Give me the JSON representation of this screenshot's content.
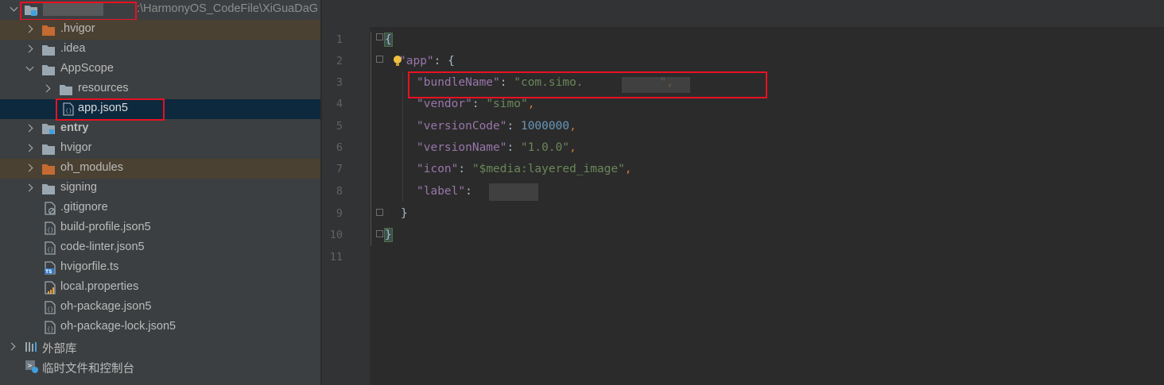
{
  "project_tree": {
    "root": {
      "path_suffix": ":\\HarmonyOS_CodeFile\\XiGuaDaG"
    },
    "items": [
      {
        "label": ".hvigor",
        "type": "folder",
        "expanded": false,
        "excluded": true
      },
      {
        "label": ".idea",
        "type": "folder",
        "expanded": false
      },
      {
        "label": "AppScope",
        "type": "folder",
        "expanded": true
      },
      {
        "label": "resources",
        "type": "folder",
        "expanded": false
      },
      {
        "label": "app.json5",
        "type": "json5-file",
        "selected": true
      },
      {
        "label": "entry",
        "type": "module-folder",
        "expanded": false
      },
      {
        "label": "hvigor",
        "type": "folder",
        "expanded": false
      },
      {
        "label": "oh_modules",
        "type": "folder",
        "expanded": false,
        "excluded": true
      },
      {
        "label": "signing",
        "type": "folder",
        "expanded": false
      },
      {
        "label": ".gitignore",
        "type": "ignore-file"
      },
      {
        "label": "build-profile.json5",
        "type": "json5-file"
      },
      {
        "label": "code-linter.json5",
        "type": "json5-file"
      },
      {
        "label": "hvigorfile.ts",
        "type": "ts-file"
      },
      {
        "label": "local.properties",
        "type": "properties-file"
      },
      {
        "label": "oh-package.json5",
        "type": "json5-file"
      },
      {
        "label": "oh-package-lock.json5",
        "type": "json5-file"
      },
      {
        "label": "外部库",
        "type": "libraries"
      },
      {
        "label": "临时文件和控制台",
        "type": "scratches"
      }
    ]
  },
  "editor": {
    "line_numbers": [
      "1",
      "2",
      "3",
      "4",
      "5",
      "6",
      "7",
      "8",
      "9",
      "10",
      "11"
    ],
    "lines": {
      "l1": {
        "brace": "{"
      },
      "l2": {
        "key": "\"app\"",
        "colon": ": ",
        "brace": "{"
      },
      "l3": {
        "key": "\"bundleName\"",
        "colon": ": ",
        "val": "\"com.simo.",
        "val_end": "\"",
        "comma": ","
      },
      "l4": {
        "key": "\"vendor\"",
        "colon": ": ",
        "val": "\"simo\"",
        "comma": ","
      },
      "l5": {
        "key": "\"versionCode\"",
        "colon": ": ",
        "num": "1000000",
        "comma": ","
      },
      "l6": {
        "key": "\"versionName\"",
        "colon": ": ",
        "val": "\"1.0.0\"",
        "comma": ","
      },
      "l7": {
        "key": "\"icon\"",
        "colon": ": ",
        "val": "\"$media:layered_image\"",
        "comma": ","
      },
      "l8": {
        "key": "\"label\"",
        "colon": ": "
      },
      "l9": {
        "brace": "}"
      },
      "l10": {
        "brace": "}"
      }
    }
  },
  "colors": {
    "sidebar_bg": "#3c3f41",
    "editor_bg": "#2b2b2b",
    "selection": "#0d293e",
    "excluded_folder": "#c46a33",
    "highlight_box": "#e81123",
    "key": "#9876aa",
    "string": "#6a8759",
    "number": "#6897bb",
    "punctuation": "#cc7832"
  },
  "icons": [
    "chevron-right-icon",
    "chevron-down-icon",
    "folder-icon",
    "module-folder-icon",
    "json5-file-icon",
    "ts-file-icon",
    "ignore-file-icon",
    "properties-file-icon",
    "libraries-icon",
    "scratches-icon",
    "lightbulb-icon",
    "fold-marker-icon"
  ]
}
